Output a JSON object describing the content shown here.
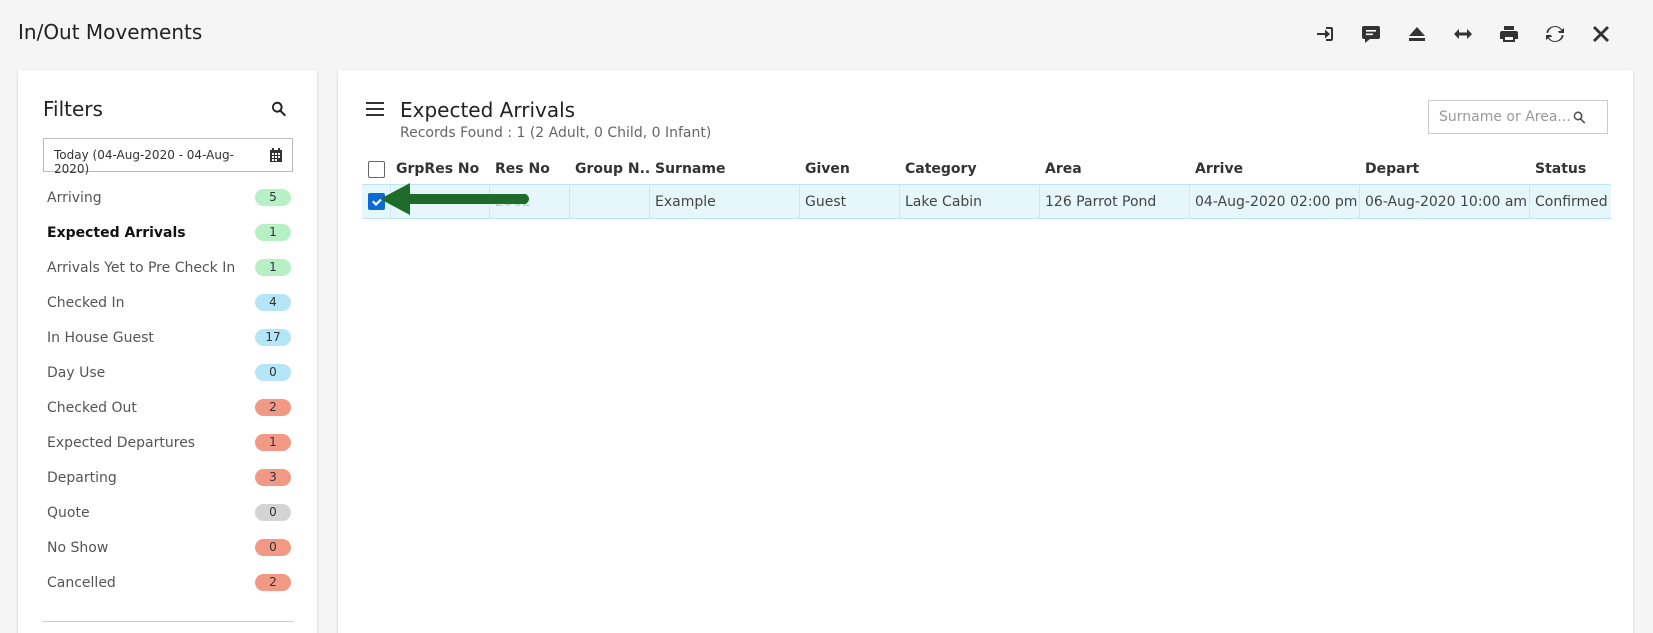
{
  "app": {
    "title": "In/Out Movements"
  },
  "toolbar": {
    "buttons": [
      {
        "icon": "sign-in-icon",
        "label": "Check In"
      },
      {
        "icon": "comment-icon",
        "label": "Messages"
      },
      {
        "icon": "eject-icon",
        "label": "Eject"
      },
      {
        "icon": "arrows-h-icon",
        "label": "Expand"
      },
      {
        "icon": "print-icon",
        "label": "Print"
      },
      {
        "icon": "refresh-icon",
        "label": "Refresh"
      },
      {
        "icon": "close-icon",
        "label": "Close"
      }
    ]
  },
  "filters": {
    "title": "Filters",
    "date_range": "Today (04-Aug-2020 - 04-Aug-2020)",
    "items": [
      {
        "label": "Arriving",
        "count": "5",
        "color": "green"
      },
      {
        "label": "Expected Arrivals",
        "count": "1",
        "color": "green",
        "active": true
      },
      {
        "label": "Arrivals Yet to Pre Check In",
        "count": "1",
        "color": "green"
      },
      {
        "label": "Checked In",
        "count": "4",
        "color": "blue"
      },
      {
        "label": "In House Guest",
        "count": "17",
        "color": "blue"
      },
      {
        "label": "Day Use",
        "count": "0",
        "color": "blue"
      },
      {
        "label": "Checked Out",
        "count": "2",
        "color": "red"
      },
      {
        "label": "Expected Departures",
        "count": "1",
        "color": "red"
      },
      {
        "label": "Departing",
        "count": "3",
        "color": "red"
      },
      {
        "label": "Quote",
        "count": "0",
        "color": "grey"
      },
      {
        "label": "No Show",
        "count": "0",
        "color": "red"
      },
      {
        "label": "Cancelled",
        "count": "2",
        "color": "red"
      }
    ]
  },
  "main": {
    "title": "Expected Arrivals",
    "records_found": "Records Found : 1 (2 Adult, 0 Child, 0 Infant)",
    "search_placeholder": "Surname or Area...",
    "columns": [
      "GrpRes No",
      "Res No",
      "Group N...",
      "Surname",
      "Given",
      "Category",
      "Area",
      "Arrive",
      "Depart",
      "Status"
    ],
    "rows": [
      {
        "checked": true,
        "grp_res_no": "0",
        "res_no": "2062",
        "group_name": "",
        "surname": "Example",
        "given": "Guest",
        "category": "Lake Cabin",
        "area": "126 Parrot Pond",
        "arrive": "04-Aug-2020 02:00 pm",
        "depart": "06-Aug-2020 10:00 am",
        "status": "Confirmed"
      }
    ]
  },
  "colors": {
    "badge_green": "#b8f0c6",
    "badge_blue": "#b5e6f7",
    "badge_red": "#f29985",
    "badge_grey": "#d4d4d4",
    "row_selected": "#e6f7fb",
    "checkbox_checked": "#0b6bd6",
    "arrow": "#1f6b2a"
  }
}
